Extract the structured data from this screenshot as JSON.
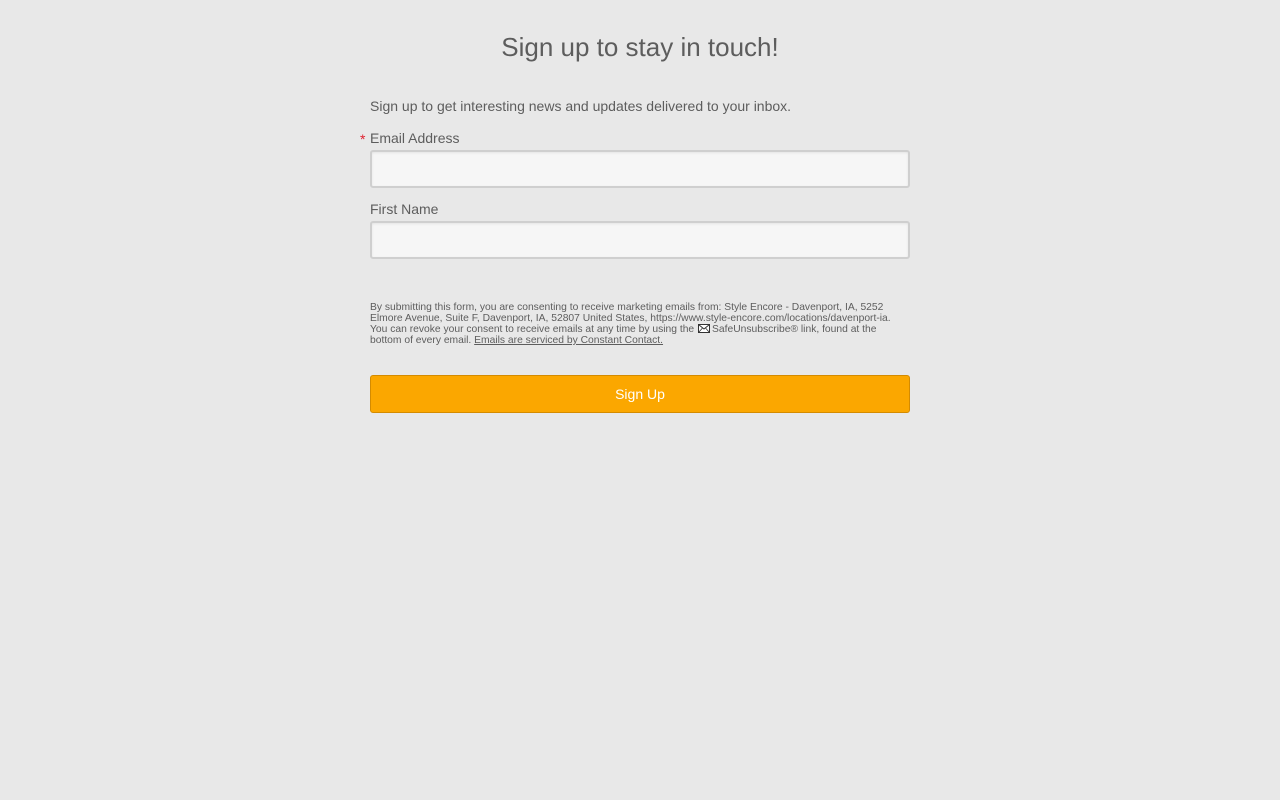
{
  "form": {
    "title": "Sign up to stay in touch!",
    "intro": "Sign up to get interesting news and updates delivered to your inbox.",
    "required_marker": "*",
    "fields": {
      "email": {
        "label": "Email Address",
        "value": "",
        "placeholder": "",
        "required": true
      },
      "first_name": {
        "label": "First Name",
        "value": "",
        "placeholder": "",
        "required": false
      }
    },
    "consent": {
      "text_before_icon": "By submitting this form, you are consenting to receive marketing emails from: Style Encore - Davenport, IA, 5252 Elmore Avenue, Suite F, Davenport, IA, 52807 United States, https://www.style-encore.com/locations/davenport-ia. You can revoke your consent to receive emails at any time by using the",
      "icon": "envelope-icon",
      "text_after_icon": "SafeUnsubscribe® link, found at the bottom of every email.",
      "link_text": "Emails are serviced by Constant Contact."
    },
    "submit_label": "Sign Up"
  },
  "colors": {
    "background": "#e8e8e8",
    "text": "#5d5d5d",
    "required": "#e0202f",
    "button": "#fba700",
    "button_text": "#ffffff"
  }
}
